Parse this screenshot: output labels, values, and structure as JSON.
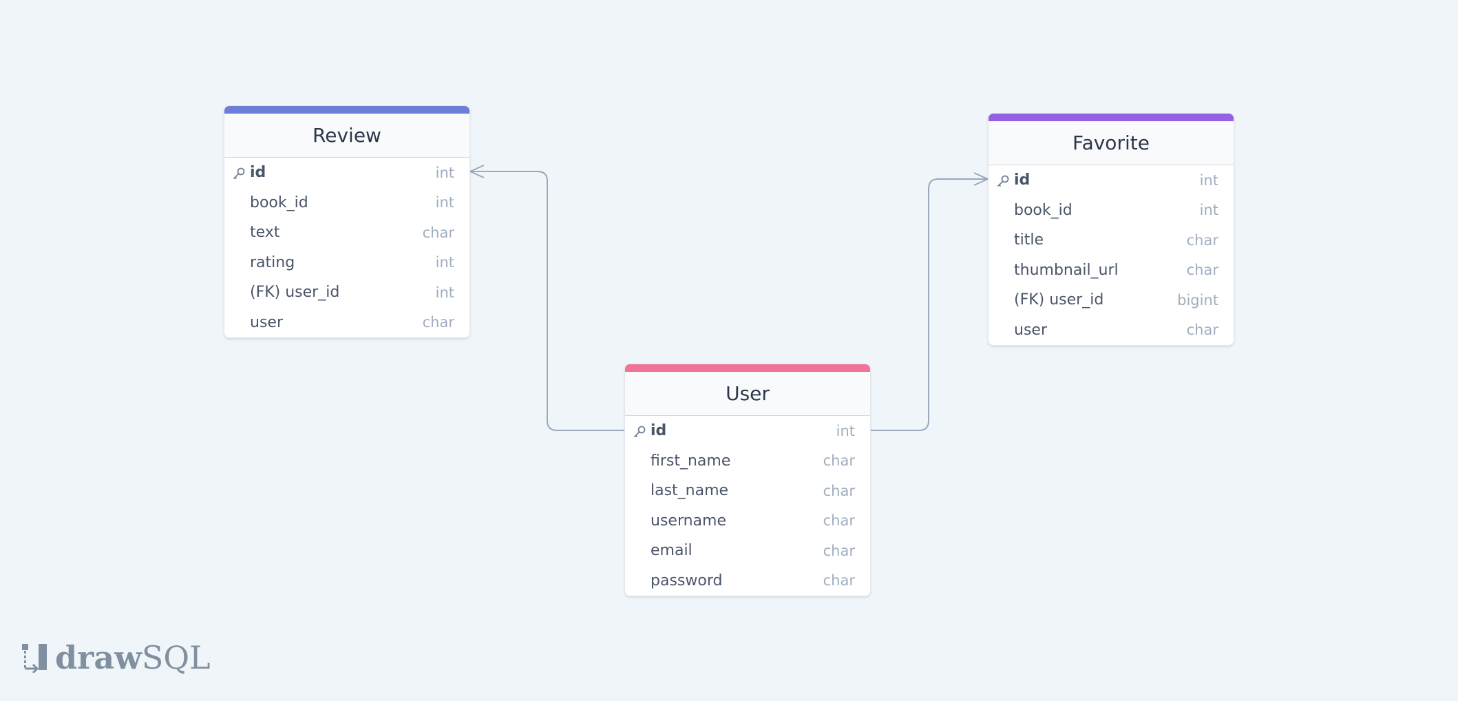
{
  "colors": {
    "background": "#f0f5f9",
    "review_bar": "#6b7fd7",
    "favorite_bar": "#9461e2",
    "user_bar": "#f27398",
    "connector": "#9aa9bb"
  },
  "tables": {
    "review": {
      "title": "Review",
      "columns": [
        {
          "name": "id",
          "type": "int",
          "pk": true
        },
        {
          "name": "book_id",
          "type": "int"
        },
        {
          "name": "text",
          "type": "char"
        },
        {
          "name": "rating",
          "type": "int"
        },
        {
          "name": "(FK) user_id",
          "type": "int"
        },
        {
          "name": "user",
          "type": "char"
        }
      ]
    },
    "favorite": {
      "title": "Favorite",
      "columns": [
        {
          "name": "id",
          "type": "int",
          "pk": true
        },
        {
          "name": "book_id",
          "type": "int"
        },
        {
          "name": "title",
          "type": "char"
        },
        {
          "name": "thumbnail_url",
          "type": "char"
        },
        {
          "name": "(FK) user_id",
          "type": "bigint"
        },
        {
          "name": "user",
          "type": "char"
        }
      ]
    },
    "user": {
      "title": "User",
      "columns": [
        {
          "name": "id",
          "type": "int",
          "pk": true
        },
        {
          "name": "first_name",
          "type": "char"
        },
        {
          "name": "last_name",
          "type": "char"
        },
        {
          "name": "username",
          "type": "char"
        },
        {
          "name": "email",
          "type": "char"
        },
        {
          "name": "password",
          "type": "char"
        }
      ]
    }
  },
  "relations": [
    {
      "from": "user.id",
      "to": "review.id",
      "cardinality": "one-to-many"
    },
    {
      "from": "user.id",
      "to": "favorite.id",
      "cardinality": "one-to-many"
    }
  ],
  "logo": {
    "bold": "draw",
    "light": "SQL",
    "icon": "drawsql-logo-icon"
  }
}
